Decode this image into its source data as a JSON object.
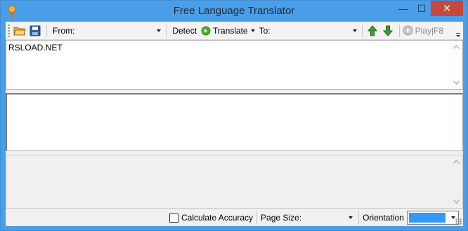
{
  "window": {
    "title": "Free Language Translator",
    "close_glyph": "✕",
    "minimize_glyph": "—",
    "maximize_glyph": "☐"
  },
  "toolbar": {
    "from_label": "From:",
    "from_value": "",
    "detect_label": "Detect",
    "translate_label": "Translate",
    "to_label": "To:",
    "to_value": "",
    "play_label": "Play|F8",
    "icons": [
      "open-folder-icon",
      "save-icon",
      "translate-go-icon",
      "up-arrow-icon",
      "down-arrow-icon",
      "play-icon"
    ]
  },
  "source_pane": {
    "text": "RSLOAD.NET"
  },
  "target_pane": {
    "text": ""
  },
  "statusbar": {
    "accuracy_label": "Calculate Accuracy",
    "accuracy_checked": false,
    "page_size_label": "Page Size:",
    "page_size_value": "",
    "orientation_label": "Orientation",
    "orientation_color": "#3399ff"
  },
  "colors": {
    "title_bar": "#4a9ee8",
    "close_button": "#c7473d",
    "arrow_green": "#3aa12c"
  }
}
